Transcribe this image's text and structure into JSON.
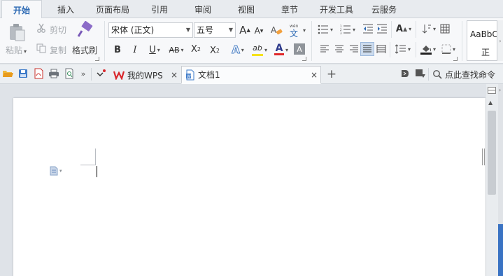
{
  "menu": {
    "tabs": [
      "开始",
      "插入",
      "页面布局",
      "引用",
      "审阅",
      "视图",
      "章节",
      "开发工具",
      "云服务"
    ],
    "active": "开始"
  },
  "ribbon": {
    "paste_label": "粘贴",
    "cut_label": "剪切",
    "copy_label": "复制",
    "format_painter_label": "格式刷",
    "font_name": "宋体 (正文)",
    "font_size": "五号",
    "grow_font": "A",
    "shrink_font": "A",
    "phonetic_char": "文",
    "bold": "B",
    "italic": "I",
    "underline": "U",
    "strikethrough": "AB",
    "superscript": "X",
    "subscript": "X",
    "text_effect": "A",
    "highlight": "ab",
    "font_color": "A",
    "char_shading": "A",
    "style_preview": "AaBbC",
    "style_name": "正文"
  },
  "quickbar": {
    "tabs": [
      {
        "label": "我的WPS",
        "close": "×"
      },
      {
        "label": "文档1",
        "close": "×"
      }
    ],
    "new_tab": "+",
    "search_placeholder": "点此查找命令"
  },
  "colors": {
    "accent": "#2d6ab4",
    "wps_red": "#d9262b",
    "highlight_yellow": "#f5e21b",
    "font_red": "#e0282b"
  }
}
